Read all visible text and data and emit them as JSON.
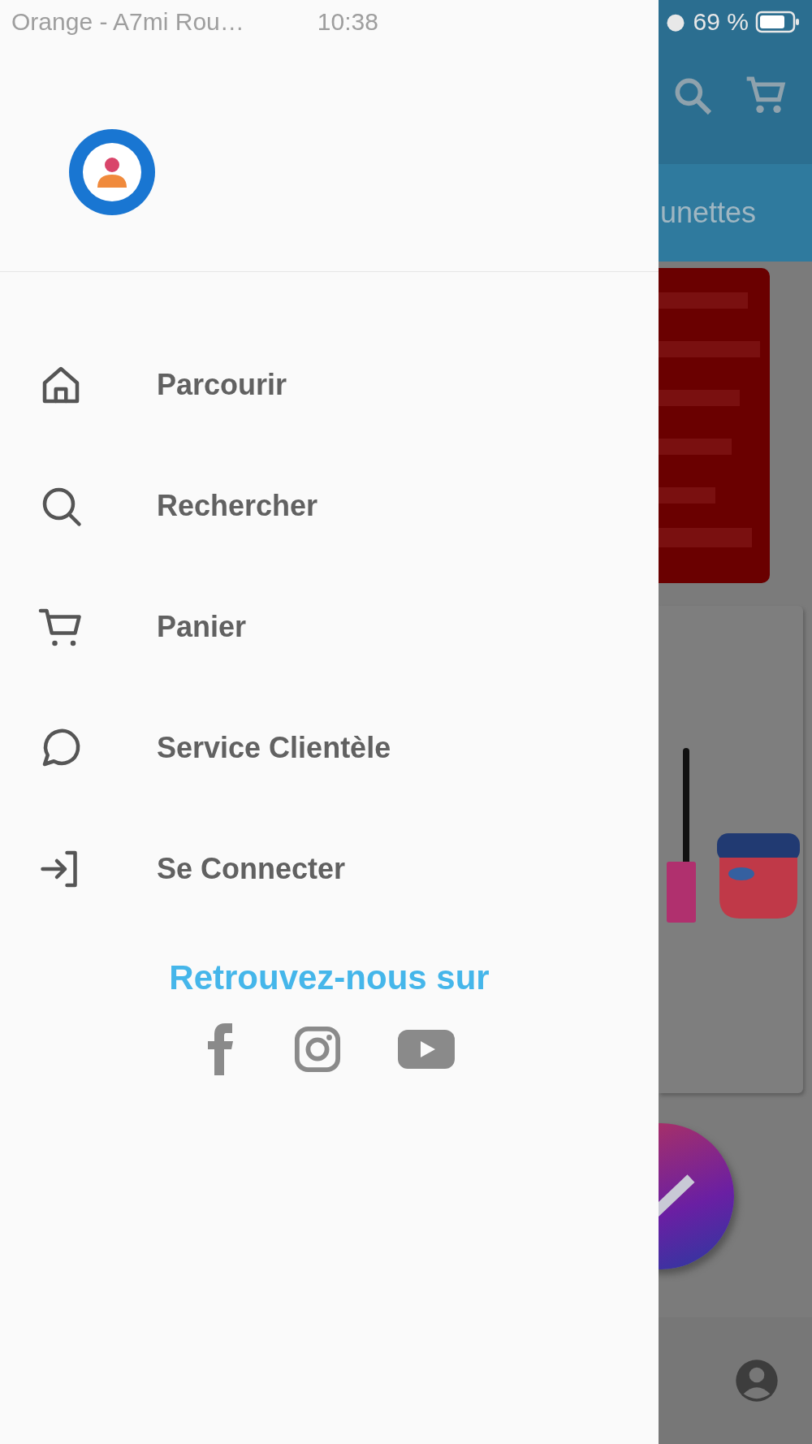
{
  "status_bar": {
    "carrier": "Orange - A7mi Rou…",
    "time": "10:38",
    "battery": "69 %"
  },
  "drawer": {
    "menu": [
      {
        "label": "Parcourir",
        "kind": "home"
      },
      {
        "label": "Rechercher",
        "kind": "search"
      },
      {
        "label": "Panier",
        "kind": "cart"
      },
      {
        "label": "Service Clientèle",
        "kind": "chat"
      },
      {
        "label": "Se Connecter",
        "kind": "login"
      }
    ],
    "social": {
      "title": "Retrouvez-nous sur",
      "links": [
        {
          "kind": "facebook"
        },
        {
          "kind": "instagram"
        },
        {
          "kind": "youtube"
        }
      ]
    }
  },
  "background_screen": {
    "tab": "unettes"
  }
}
